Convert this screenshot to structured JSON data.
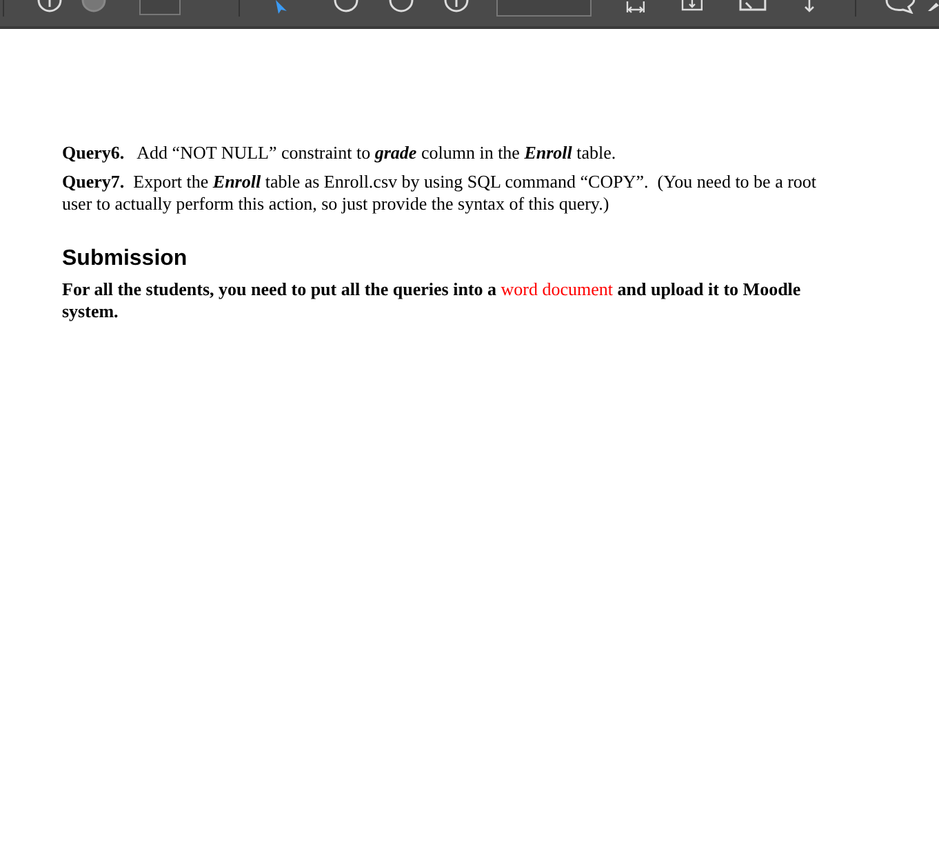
{
  "queries": [
    {
      "text": "**Query6.**   Add “NOT NULL” constraint to *grade* column in the *Enroll* table."
    },
    {
      "text": "**Query7.**  Export the *Enroll* table as Enroll.csv by using SQL command “COPY”.  (You need to be a root user to actually perform this action, so just provide the syntax of this query.)"
    }
  ],
  "submission": {
    "heading": "Submission",
    "parts": [
      {
        "text": "For all the students, you need to put all the queries into a ",
        "highlighted": false
      },
      {
        "text": "word document",
        "highlighted": true
      },
      {
        "text": " and upload it to Moodle system.",
        "highlighted": false
      }
    ]
  }
}
